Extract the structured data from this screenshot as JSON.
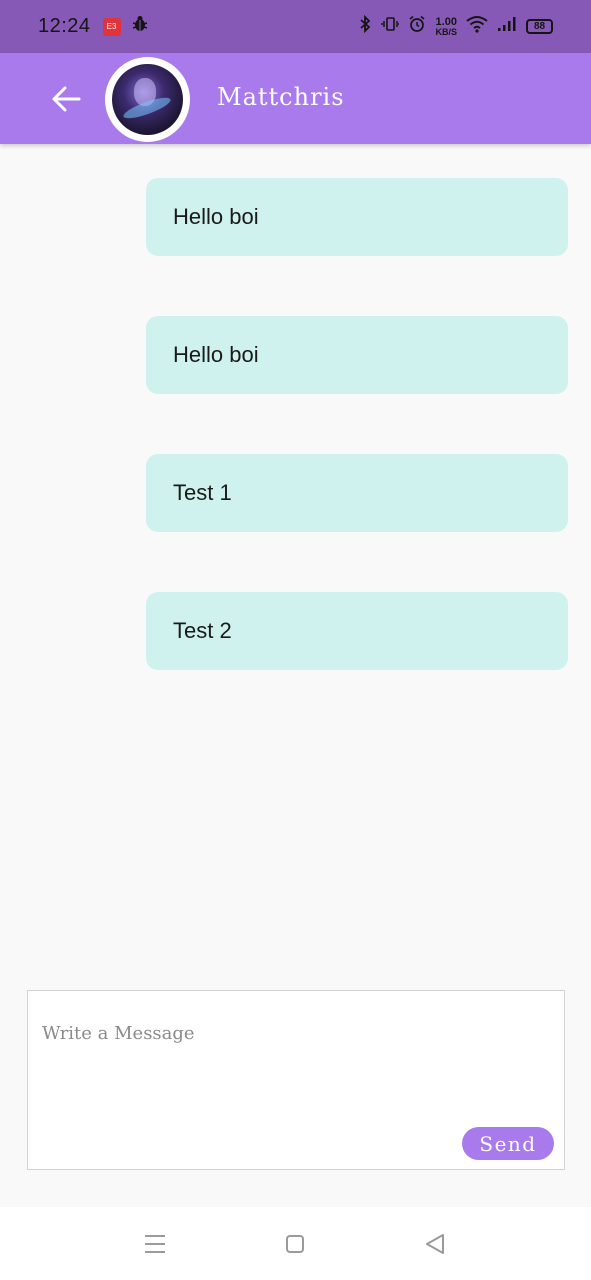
{
  "status_bar": {
    "time": "12:24",
    "net_speed_value": "1.00",
    "net_speed_unit": "KB/S",
    "battery": "88",
    "app_badge": "E3",
    "icons": [
      "bluetooth-icon",
      "vibrate-icon",
      "alarm-icon",
      "wifi-icon",
      "signal-icon"
    ]
  },
  "header": {
    "contact_name": "Mattchris",
    "background_color": "#a97aec",
    "status_bar_color": "#8559b5"
  },
  "messages": [
    {
      "text": "Hello boi"
    },
    {
      "text": "Hello boi"
    },
    {
      "text": "Test 1"
    },
    {
      "text": "Test 2"
    }
  ],
  "bubble_color": "#cff2ef",
  "composer": {
    "placeholder": "Write a Message",
    "send_label": "Send"
  },
  "nav_bar": {
    "icons": [
      "menu-icon",
      "home-icon",
      "back-triangle-icon"
    ]
  }
}
